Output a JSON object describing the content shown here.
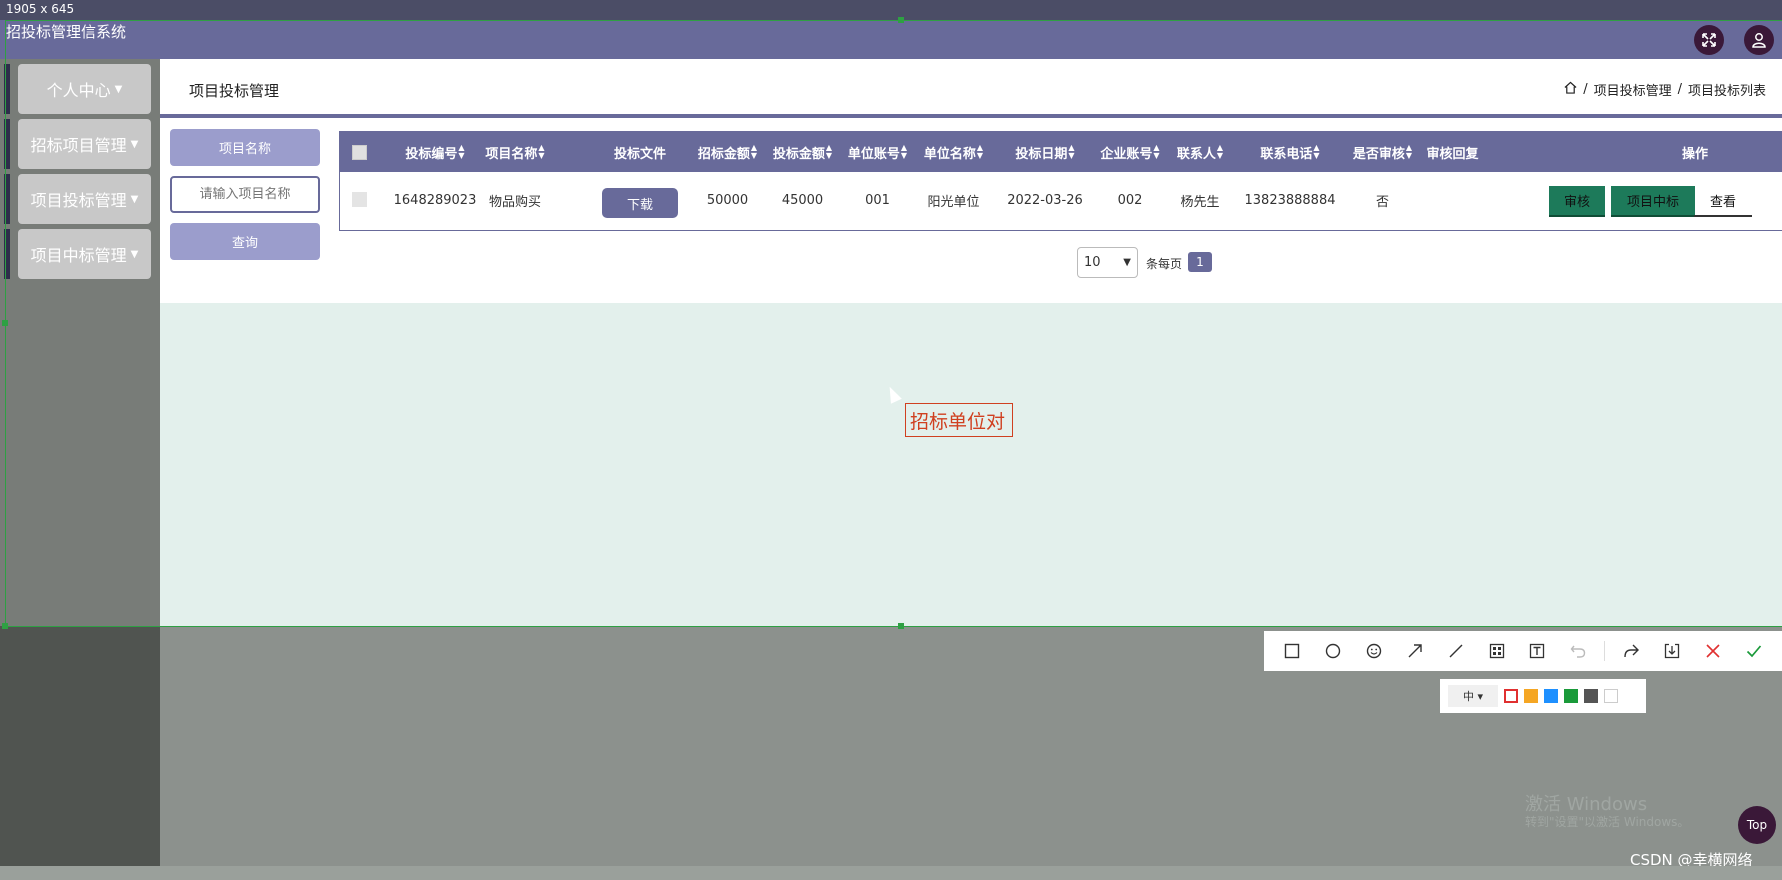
{
  "capture": {
    "dimensions": "1905 x 645"
  },
  "app": {
    "title": "招投标管理信系统"
  },
  "header": {
    "fullscreen_icon": "expand-icon",
    "user_icon": "user-icon"
  },
  "sidebar": {
    "items": [
      {
        "label": "个人中心"
      },
      {
        "label": "招标项目管理"
      },
      {
        "label": "项目投标管理"
      },
      {
        "label": "项目中标管理"
      }
    ]
  },
  "page": {
    "title": "项目投标管理",
    "breadcrumb": [
      "项目投标管理",
      "项目投标列表"
    ],
    "breadcrumb_sep": "/"
  },
  "search": {
    "label": "项目名称",
    "placeholder": "请输入项目名称",
    "button": "查询"
  },
  "table": {
    "columns": [
      "投标编号",
      "项目名称",
      "投标文件",
      "招标金额",
      "投标金额",
      "单位账号",
      "单位名称",
      "投标日期",
      "企业账号",
      "联系人",
      "联系电话",
      "是否审核",
      "审核回复",
      "操作"
    ],
    "rows": [
      {
        "bid_no": "1648289023",
        "project_name": "物品购买",
        "file_button": "下载",
        "tender_amount": "50000",
        "bid_amount": "45000",
        "unit_account": "001",
        "unit_name": "阳光单位",
        "bid_date": "2022-03-26",
        "company_account": "002",
        "contact": "杨先生",
        "phone": "13823888884",
        "reviewed": "否",
        "review_reply": "",
        "actions": {
          "review": "审核",
          "win": "项目中标",
          "view": "查看"
        }
      }
    ]
  },
  "pagination": {
    "page_size": "10",
    "per_page_label": "条每页",
    "current_page": "1"
  },
  "annotation": {
    "text": "招标单位对"
  },
  "toolbar": {
    "tools": [
      "rectangle-icon",
      "ellipse-icon",
      "emoji-icon",
      "arrow-icon",
      "line-icon",
      "mosaic-icon",
      "text-icon",
      "undo-icon",
      "share-icon",
      "save-icon",
      "close-icon",
      "confirm-icon"
    ],
    "font_size": "中",
    "colors": [
      "#e03030",
      "#f5a623",
      "#1e90ff",
      "#1a9a3a",
      "#555555",
      "#ffffff"
    ]
  },
  "watermark": {
    "line1": "激活 Windows",
    "line2": "转到\"设置\"以激活 Windows。"
  },
  "top_button": "Top",
  "credit": "CSDN @幸横网络"
}
